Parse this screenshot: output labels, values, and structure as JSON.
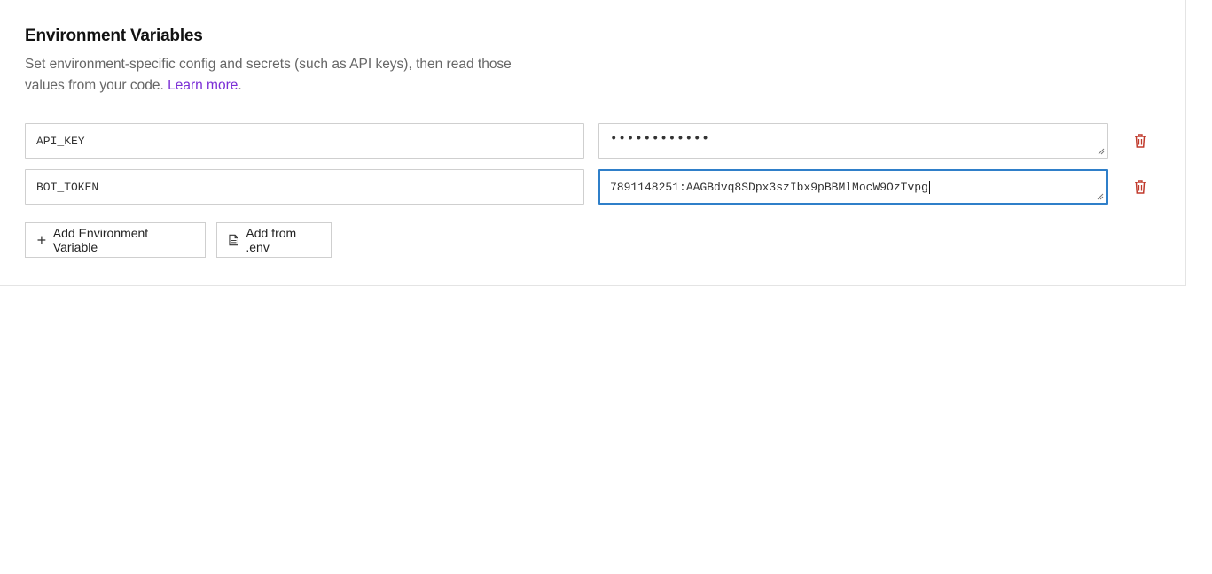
{
  "section": {
    "title": "Environment Variables",
    "description": "Set environment-specific config and secrets (such as API keys), then read those values from your code.",
    "learn_more": "Learn more"
  },
  "env_vars": [
    {
      "key": "API_KEY",
      "value_masked": "••••••••••••",
      "value_visible": false
    },
    {
      "key": "BOT_TOKEN",
      "value": "7891148251:AAGBdvq8SDpx3szIbx9pBBMlMocW9OzTvpg",
      "value_visible": true,
      "focused": true
    }
  ],
  "actions": {
    "add_label": "Add Environment Variable",
    "add_from_env_label": "Add from .env"
  },
  "icons": {
    "delete": "trash-icon",
    "add": "plus-icon",
    "file": "file-icon"
  },
  "colors": {
    "link": "#7b2fd6",
    "delete": "#c0392b",
    "focus": "#2f7fc9"
  }
}
